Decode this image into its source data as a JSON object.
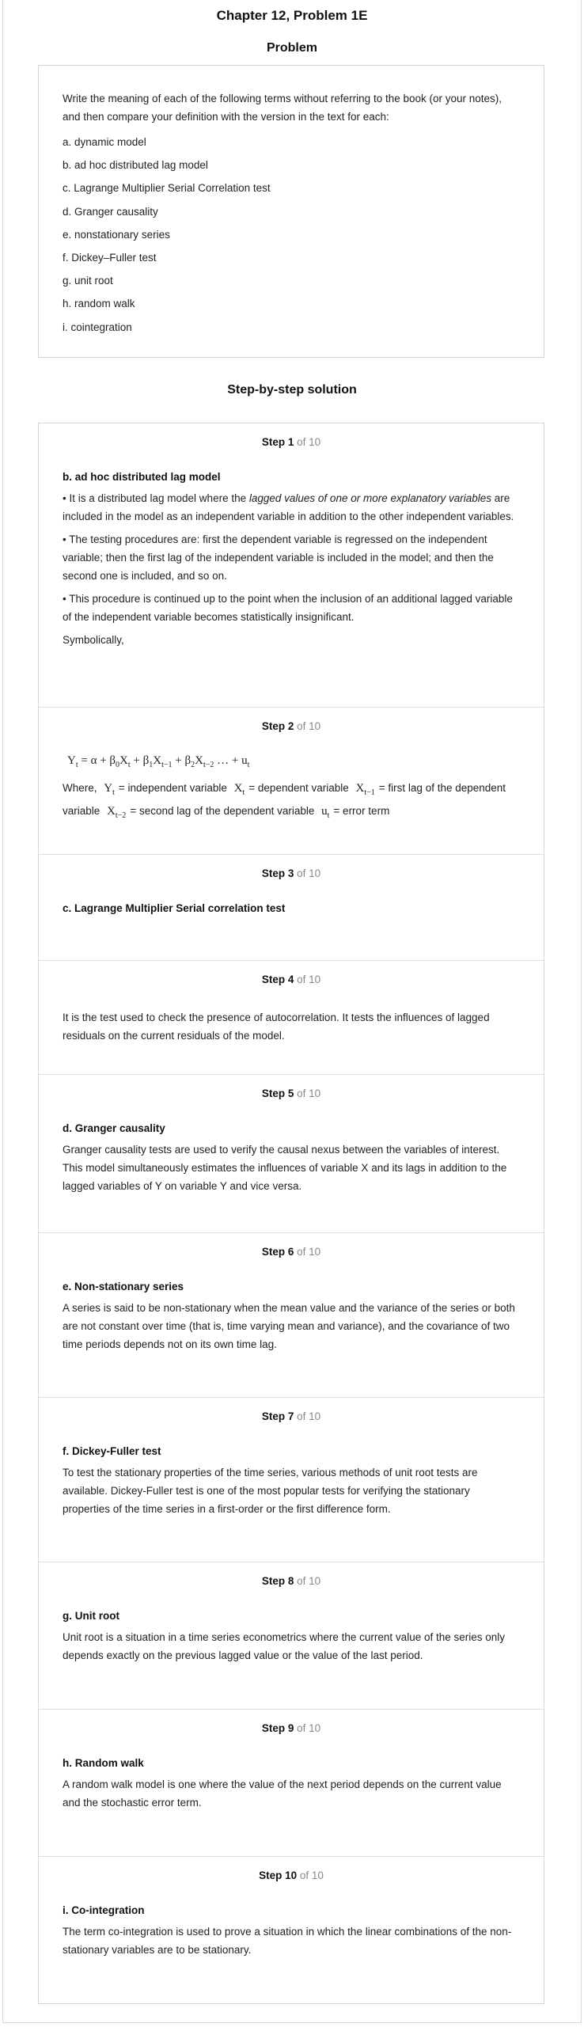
{
  "header": {
    "chapter_title": "Chapter 12, Problem 1E",
    "problem_heading": "Problem"
  },
  "problem": {
    "intro": "Write the meaning of each of the following terms without referring to the book (or your notes), and then compare your definition with the version in the text for each:",
    "items": [
      "a. dynamic model",
      "b. ad hoc distributed lag model",
      "c. Lagrange Multiplier Serial Correlation test",
      "d. Granger causality",
      "e. nonstationary series",
      "f. Dickey–Fuller test",
      "g. unit root",
      "h. random walk",
      "i. cointegration"
    ]
  },
  "solution": {
    "heading": "Step-by-step solution",
    "of_label": "of 10",
    "steps": [
      {
        "label": "Step 1",
        "heading": "b. ad hoc distributed lag model",
        "bullet1_pre": "• It is a distributed lag model where the ",
        "bullet1_em": "lagged values of one or more explanatory variables",
        "bullet1_post": " are included in the model as an independent variable in addition to the other independent variables.",
        "bullet2": "• The testing procedures are: first the dependent variable is regressed on the independent variable; then the first lag of the independent variable is included in the model; and then the second one is included, and so on.",
        "bullet3": "• This procedure is continued up to the point when the inclusion of an additional lagged variable of the independent variable becomes statistically insignificant.",
        "symbolically": "Symbolically,"
      },
      {
        "label": "Step 2",
        "equation": "Yt = α + β0Xt + β1Xt−1 + β2Xt−2 … + ut",
        "where": "Where,",
        "def1": "= independent variable",
        "def2": "= dependent variable",
        "def3": "= first lag of the dependent variable",
        "def4": "= second lag of the dependent variable",
        "def5": "= error term"
      },
      {
        "label": "Step 3",
        "heading": "c. Lagrange Multiplier Serial correlation test"
      },
      {
        "label": "Step 4",
        "text": "It is the test used to check the presence of autocorrelation. It tests the influences of lagged residuals on the current residuals of the model."
      },
      {
        "label": "Step 5",
        "heading": "d. Granger causality",
        "text": "Granger causality tests are used to verify the causal nexus between the variables of interest. This model simultaneously estimates the influences of variable X and its lags in addition to the lagged variables of Y on variable Y and vice versa."
      },
      {
        "label": "Step 6",
        "heading": "e. Non-stationary series",
        "text": "A series is said to be non-stationary when the mean value and the variance of the series or both are not constant over time (that is, time varying mean and variance), and the covariance of two time periods depends not on its own time lag."
      },
      {
        "label": "Step 7",
        "heading": "f. Dickey-Fuller test",
        "text": "To test the stationary properties of the time series, various methods of unit root tests are available. Dickey-Fuller test is one of the most popular tests for verifying the stationary properties of the time series in a first-order or the first difference form."
      },
      {
        "label": "Step 8",
        "heading": "g. Unit root",
        "text": "Unit root is a situation in a time series econometrics where the current value of the series only depends exactly on the previous lagged value or the value of the last period."
      },
      {
        "label": "Step 9",
        "heading": "h. Random walk",
        "text": "A random walk model is one where the value of the next period depends on the current value and the stochastic error term."
      },
      {
        "label": "Step 10",
        "heading": "i. Co-integration",
        "text": "The term co-integration is used to prove a situation in which the linear combinations of the non-stationary variables are to be stationary."
      }
    ]
  }
}
